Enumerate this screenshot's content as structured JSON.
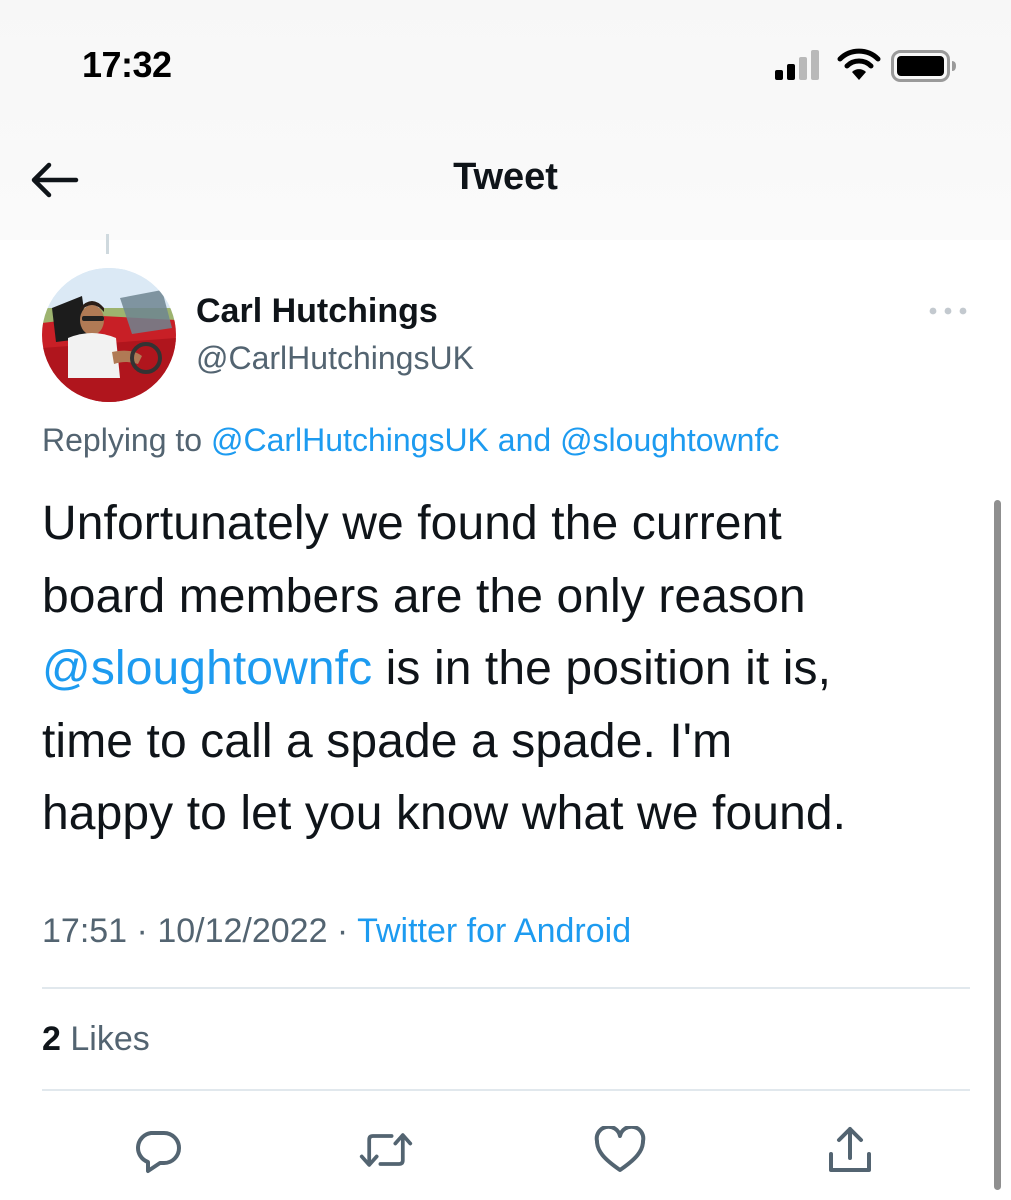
{
  "status_bar": {
    "time": "17:32"
  },
  "header": {
    "title": "Tweet"
  },
  "author": {
    "name": "Carl Hutchings",
    "handle": "@CarlHutchingsUK"
  },
  "replying": {
    "prefix": "Replying to ",
    "mention_1": "@CarlHutchingsUK",
    "conjunction": " and ",
    "mention_2": "@sloughtownfc"
  },
  "tweet": {
    "line_1": "Unfortunately we found the current",
    "line_2": "board members are the only reason",
    "line_3_mention": "@sloughtownfc",
    "line_3_rest": " is in the position it is,",
    "line_4": "time to call a spade a spade. I'm",
    "line_5": "happy to let you know what we found."
  },
  "meta": {
    "time": "17:51",
    "separator": " · ",
    "date": "10/12/2022",
    "source": "Twitter for Android"
  },
  "stats": {
    "likes_count": "2",
    "likes_label": " Likes"
  },
  "icons": {
    "back": "arrow-left-icon",
    "more": "more-horizontal-icon",
    "reply": "reply-icon",
    "retweet": "retweet-icon",
    "like": "heart-icon",
    "share": "share-icon"
  },
  "colors": {
    "accent": "#1d9bf0",
    "text_primary": "#0f1419",
    "text_secondary": "#536471",
    "divider": "#e1e8ed"
  }
}
